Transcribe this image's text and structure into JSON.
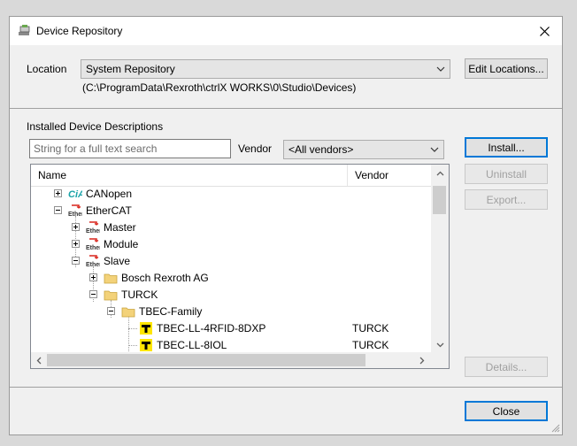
{
  "window": {
    "title": "Device Repository"
  },
  "location": {
    "label": "Location",
    "selected": "System Repository",
    "path": "(C:\\ProgramData\\Rexroth\\ctrlX WORKS\\0\\Studio\\Devices)",
    "edit_button": "Edit Locations..."
  },
  "installed": {
    "section_label": "Installed Device Descriptions",
    "search_placeholder": "String for a full text search",
    "vendor_label": "Vendor",
    "vendor_selected": "<All vendors>",
    "columns": {
      "name": "Name",
      "vendor": "Vendor"
    },
    "tree": [
      {
        "label": "CANopen",
        "vendor": "",
        "icon": "cia-icon",
        "state": "collapsed"
      },
      {
        "label": "EtherCAT",
        "vendor": "",
        "icon": "ethercat-icon",
        "state": "expanded"
      },
      {
        "label": "Master",
        "vendor": "",
        "icon": "ethercat-icon",
        "state": "collapsed"
      },
      {
        "label": "Module",
        "vendor": "",
        "icon": "ethercat-icon",
        "state": "collapsed"
      },
      {
        "label": "Slave",
        "vendor": "",
        "icon": "ethercat-icon",
        "state": "expanded"
      },
      {
        "label": "Bosch Rexroth AG",
        "vendor": "",
        "icon": "folder-icon",
        "state": "collapsed"
      },
      {
        "label": "TURCK",
        "vendor": "",
        "icon": "folder-icon",
        "state": "expanded"
      },
      {
        "label": "TBEC-Family",
        "vendor": "",
        "icon": "folder-icon",
        "state": "expanded"
      },
      {
        "label": "TBEC-LL-4RFID-8DXP",
        "vendor": "TURCK",
        "icon": "device-icon",
        "state": "leaf"
      },
      {
        "label": "TBEC-LL-8IOL",
        "vendor": "TURCK",
        "icon": "device-icon",
        "state": "leaf"
      }
    ]
  },
  "buttons": {
    "install": "Install...",
    "uninstall": "Uninstall",
    "export": "Export...",
    "details": "Details...",
    "close": "Close"
  },
  "colors": {
    "accent": "#0078d7",
    "folder": "#f3d27a",
    "ethercat_red": "#d9251c",
    "cia_teal": "#1aa3a8",
    "device_yellow": "#ffe600"
  }
}
